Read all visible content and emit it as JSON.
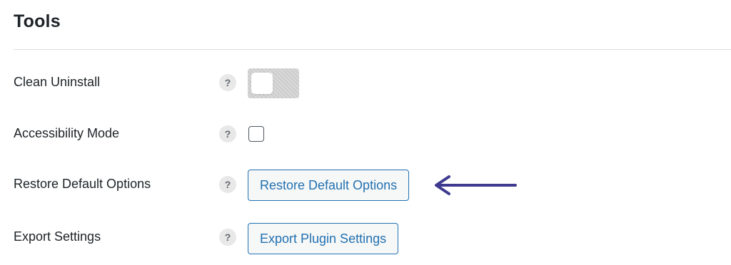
{
  "section": {
    "title": "Tools"
  },
  "rows": {
    "clean_uninstall": {
      "label": "Clean Uninstall",
      "help": "?",
      "enabled": false
    },
    "accessibility_mode": {
      "label": "Accessibility Mode",
      "help": "?",
      "checked": false
    },
    "restore_defaults": {
      "label": "Restore Default Options",
      "help": "?",
      "button_label": "Restore Default Options"
    },
    "export_settings": {
      "label": "Export Settings",
      "help": "?",
      "button_label": "Export Plugin Settings"
    }
  },
  "annotation": {
    "icon": "arrow-left-icon",
    "color": "#3f3a8f"
  },
  "colors": {
    "accent": "#2271b1",
    "toggle_off": "#d2d2d2"
  }
}
